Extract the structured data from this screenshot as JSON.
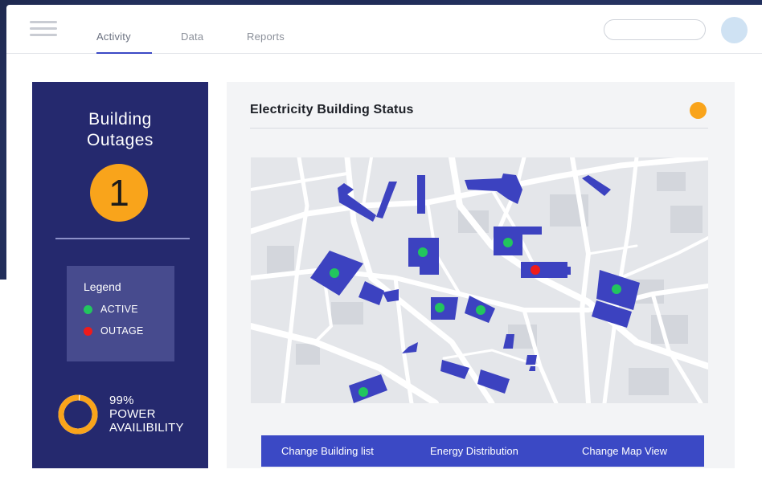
{
  "header": {
    "tabs": [
      {
        "label": "Activity"
      },
      {
        "label": "Data"
      },
      {
        "label": "Reports"
      }
    ],
    "search": {
      "placeholder": ""
    }
  },
  "sidebar": {
    "title_line1": "Building",
    "title_line2": "Outages",
    "outage_count": "1",
    "legend": {
      "title": "Legend",
      "items": [
        {
          "label": "ACTIVE",
          "color": "#22c55e"
        },
        {
          "label": "OUTAGE",
          "color": "#ef1b1b"
        }
      ]
    },
    "availability": {
      "percent_label": "99%",
      "line1": "POWER",
      "line2": "AVAILIBILITY",
      "fraction": 0.99
    }
  },
  "main": {
    "title": "Electricity Building Status",
    "status_color": "#f9a41b",
    "actions": [
      {
        "label": "Change Building list"
      },
      {
        "label": "Energy Distribution"
      },
      {
        "label": "Change Map View"
      }
    ]
  },
  "colors": {
    "accent": "#3b49c5",
    "panel": "#25296e",
    "building": "#3c42c0",
    "active": "#22c55e",
    "outage": "#ef1b1b"
  }
}
